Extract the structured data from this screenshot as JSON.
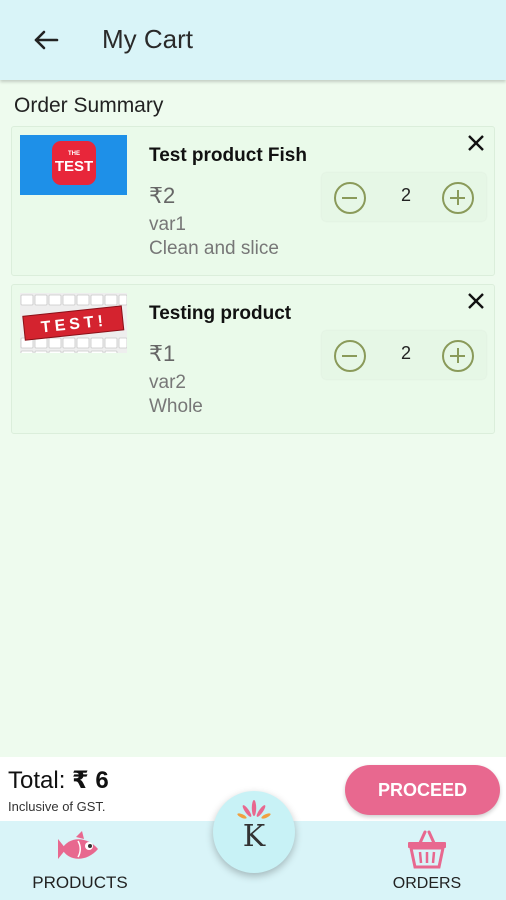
{
  "header": {
    "title": "My Cart",
    "back_icon": "arrow-left-icon"
  },
  "summary_label": "Order Summary",
  "items": [
    {
      "name": "Test product Fish",
      "price": "₹2",
      "variant": "var1",
      "cut": "Clean and slice",
      "quantity": "2",
      "thumb_text_top": "THE",
      "thumb_text_main": "TEST"
    },
    {
      "name": "Testing product",
      "price": "₹1",
      "variant": "var2",
      "cut": "Whole",
      "quantity": "2",
      "thumb_text_main": "TEST!"
    }
  ],
  "footer": {
    "total_label": "Total:",
    "total_value": "₹ 6",
    "gst_note": "Inclusive of GST.",
    "proceed_label": "PROCEED"
  },
  "bottom_nav": {
    "products_label": "PRODUCTS",
    "orders_label": "ORDERS",
    "center_letter": "K"
  },
  "colors": {
    "appbar": "#d9f4f8",
    "background": "#eefbee",
    "accent_pink": "#e8688f",
    "stepper_olive": "#8a9a5a"
  }
}
